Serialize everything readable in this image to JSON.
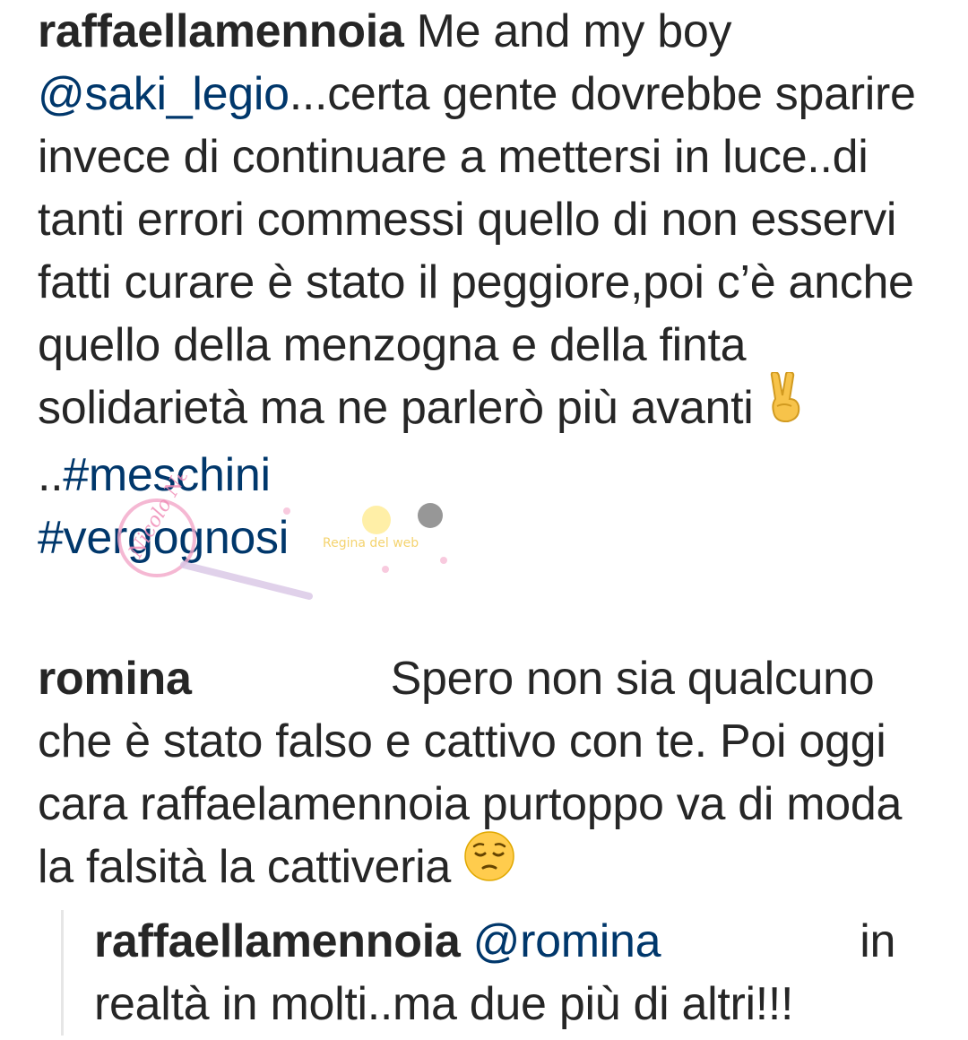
{
  "post": {
    "username": "raffaellamennoia",
    "caption_start": "Me and my boy",
    "mention": "@saki_legio",
    "caption_body": "...certa gente dovrebbe sparire invece di continuare a mettersi in luce..di tanti errori commessi quello di non esservi fatti curare è stato il peggiore,poi c’è anche quello della menzogna e della finta solidarietà ma ne parlerò più avanti",
    "victory_emoji": "victory-hand-icon",
    "caption_after_emoji": " ..",
    "hashtags": [
      "#meschini",
      "#vergognosi"
    ]
  },
  "comment": {
    "username": "romina",
    "text": "Spero non sia qualcuno che è stato falso e cattivo con te. Poi oggi cara raffaelamennoia purtoppo va di moda la falsità la cattiveria",
    "emoji": "pensive-face-icon"
  },
  "reply": {
    "username": "raffaellamennoia",
    "mention": "@romina",
    "text": "in realtà in molti..ma due più di altri!!!"
  },
  "watermark": {
    "text_main": "Nicolo News",
    "text_side": "Regina del web"
  },
  "colors": {
    "text": "#262626",
    "link": "#00376b",
    "reply_line": "#e6e6e6"
  }
}
